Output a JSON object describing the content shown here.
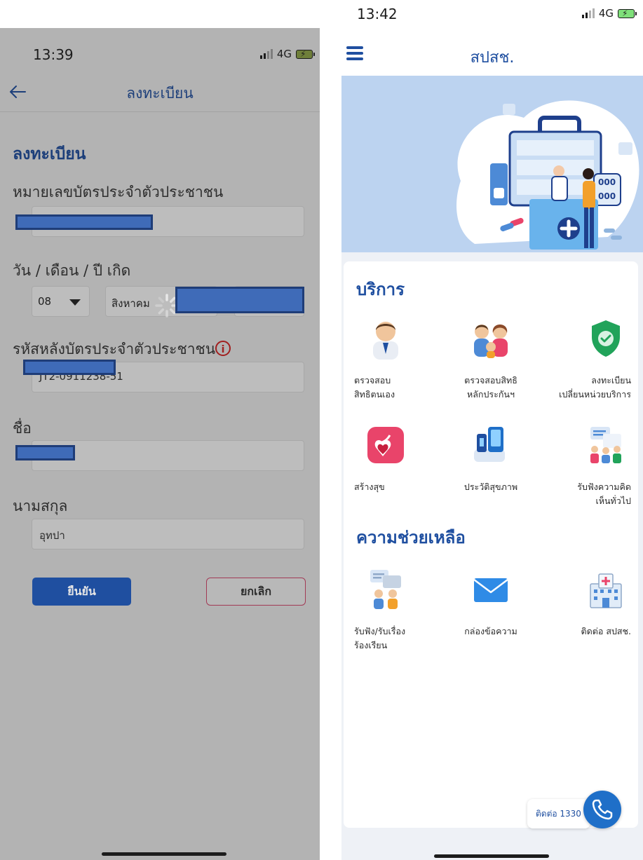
{
  "left_screen": {
    "status": {
      "time": "13:39",
      "network": "4G"
    },
    "nav": {
      "title": "ลงทะเบียน"
    },
    "form": {
      "title": "ลงทะเบียน",
      "id_label": "หมายเลขบัตรประจำตัวประชาชน",
      "dob_label": "วัน / เดือน / ปี เกิด",
      "day_value": "08",
      "month_value": "สิงหาคม",
      "card_back_label": "รหัสหลังบัตรประจำตัวประชาชน",
      "card_back_value": "JT2-0911238-51",
      "firstname_label": "ชื่อ",
      "lastname_label": "นามสกุล",
      "lastname_value": "อุทปา"
    },
    "buttons": {
      "confirm": "ยืนยัน",
      "cancel": "ยกเลิก"
    }
  },
  "right_screen": {
    "status": {
      "time": "13:42",
      "network": "4G"
    },
    "header": {
      "title": "สปสช."
    },
    "services": {
      "title": "บริการ",
      "items": [
        {
          "label": "ตรวจสอบ\nสิทธิตนเอง",
          "icon": "person-icon"
        },
        {
          "label": "ตรวจสอบสิทธิ\nหลักประกันฯ",
          "icon": "family-icon"
        },
        {
          "label": "ลงทะเบียน\nเปลี่ยนหน่วยบริการ",
          "icon": "shield-check-icon"
        },
        {
          "label": "สร้างสุข",
          "icon": "heart-ribbon-icon"
        },
        {
          "label": "ประวัติสุขภาพ",
          "icon": "health-device-icon"
        },
        {
          "label": "รับฟังความคิด\nเห็นทั่วไป",
          "icon": "meeting-icon"
        }
      ]
    },
    "help": {
      "title": "ความช่วยเหลือ",
      "items": [
        {
          "label": "รับฟัง/รับเรื่อง\nร้องเรียน",
          "icon": "chat-people-icon"
        },
        {
          "label": "กล่องข้อความ",
          "icon": "envelope-icon"
        },
        {
          "label": "ติดต่อ สปสช.",
          "icon": "hospital-icon"
        }
      ]
    },
    "contact": {
      "label": "ติดต่อ 1330"
    }
  },
  "colors": {
    "brand_blue": "#1f4fa0",
    "dim_overlay": "#b3b3b3",
    "banner_blue": "#bcd3f0"
  }
}
